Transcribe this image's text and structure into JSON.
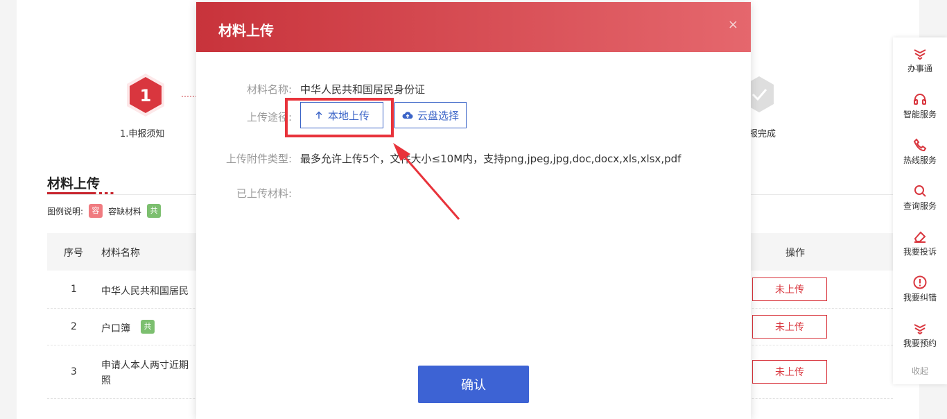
{
  "steps": [
    {
      "number": "1",
      "label": "1.申报须知"
    },
    {
      "label": "报完成"
    }
  ],
  "section": {
    "title": "材料上传"
  },
  "legend": {
    "label": "图例说明:",
    "items": [
      {
        "tag": "容",
        "text": "容缺材料"
      },
      {
        "tag": "共"
      }
    ]
  },
  "table": {
    "headers": {
      "index": "序号",
      "name": "材料名称",
      "action": "操作"
    },
    "rows": [
      {
        "index": "1",
        "name": "中华人民共和国居民",
        "status": "未上传"
      },
      {
        "index": "2",
        "name": "户口簿",
        "tag": "共",
        "status": "未上传"
      },
      {
        "index": "3",
        "name_line1": "申请人本人两寸近期",
        "name_line2": "照",
        "status": "未上传"
      }
    ]
  },
  "sidebar": {
    "items": [
      {
        "label": "办事通",
        "icon": "handshake-icon"
      },
      {
        "label": "智能服务",
        "icon": "headset-icon"
      },
      {
        "label": "热线服务",
        "icon": "phone-icon"
      },
      {
        "label": "查询服务",
        "icon": "search-icon"
      },
      {
        "label": "我要投诉",
        "icon": "eraser-icon"
      },
      {
        "label": "我要纠错",
        "icon": "alert-icon"
      },
      {
        "label": "我要预约",
        "icon": "handshake-icon"
      }
    ],
    "collapse": "收起"
  },
  "modal": {
    "title": "材料上传",
    "close": "×",
    "fields": {
      "name_label": "材料名称:",
      "name_value": "中华人民共和国居民身份证",
      "route_label": "上传途径:",
      "local_upload": "本地上传",
      "cloud_select": "云盘选择",
      "type_label": "上传附件类型:",
      "type_value": "最多允许上传5个，文件大小≤10M内，支持png,jpeg,jpg,doc,docx,xls,xlsx,pdf",
      "uploaded_label": "已上传材料:"
    },
    "confirm": "确认"
  },
  "colors": {
    "brand_red": "#c8333b",
    "accent_blue": "#3d63d4",
    "highlight_red": "#e8333b"
  }
}
